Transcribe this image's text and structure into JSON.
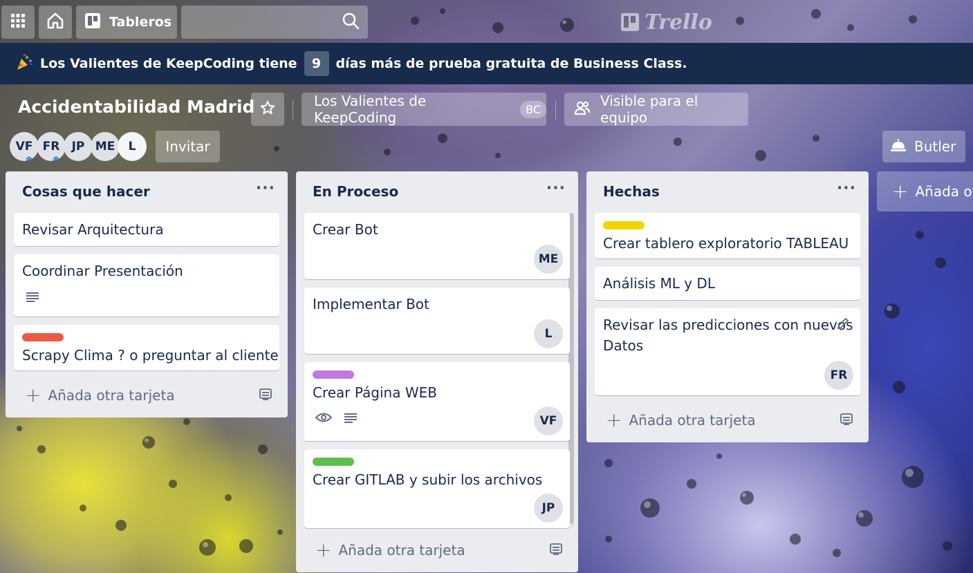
{
  "topbar": {
    "boards_label": "Tableros",
    "logo_text": "Trello"
  },
  "banner": {
    "text_before": "Los Valientes de KeepCoding tiene",
    "days": "9",
    "text_after": "días más de prueba gratuita de Business Class."
  },
  "board": {
    "title": "Accidentabilidad Madrid",
    "team_name": "Los Valientes de KeepCoding",
    "team_badge": "BC",
    "visibility": "Visible para el equipo",
    "invite_label": "Invitar",
    "butler_label": "Butler",
    "members": [
      "VF",
      "FR",
      "JP",
      "ME",
      "L"
    ],
    "add_list_label": "Añada otra lista"
  },
  "colors": {
    "label_red": "#eb5a46",
    "label_purple": "#c377e0",
    "label_green": "#61bd4f",
    "label_yellow": "#f2d600",
    "banner_bg": "#172b4d",
    "list_bg": "#ebecf0"
  },
  "lists": [
    {
      "title": "Cosas que hacer",
      "add_card_label": "Añada otra tarjeta",
      "cards": [
        {
          "title": "Revisar Arquitectura"
        },
        {
          "title": "Coordinar Presentación",
          "badges": [
            "description-icon"
          ]
        },
        {
          "title": "Scrapy Clima ? o preguntar al cliente",
          "label": "red"
        }
      ]
    },
    {
      "title": "En Proceso",
      "add_card_label": "Añada otra tarjeta",
      "cards": [
        {
          "title": "Crear Bot",
          "member": "ME"
        },
        {
          "title": "Implementar Bot",
          "member": "L"
        },
        {
          "title": "Crear Página WEB",
          "label": "purple",
          "member": "VF",
          "badges": [
            "eye-icon",
            "description-icon"
          ]
        },
        {
          "title": "Crear GITLAB y subir los archivos",
          "label": "green",
          "member": "JP"
        }
      ]
    },
    {
      "title": "Hechas",
      "add_card_label": "Añada otra tarjeta",
      "cards": [
        {
          "title": "Crear tablero exploratorio TABLEAU",
          "label": "yellow"
        },
        {
          "title": "Análisis ML y DL"
        },
        {
          "title_line1": "Revisar las predicciones con nuevos",
          "title_line2": "Datos",
          "member": "FR"
        }
      ]
    }
  ]
}
